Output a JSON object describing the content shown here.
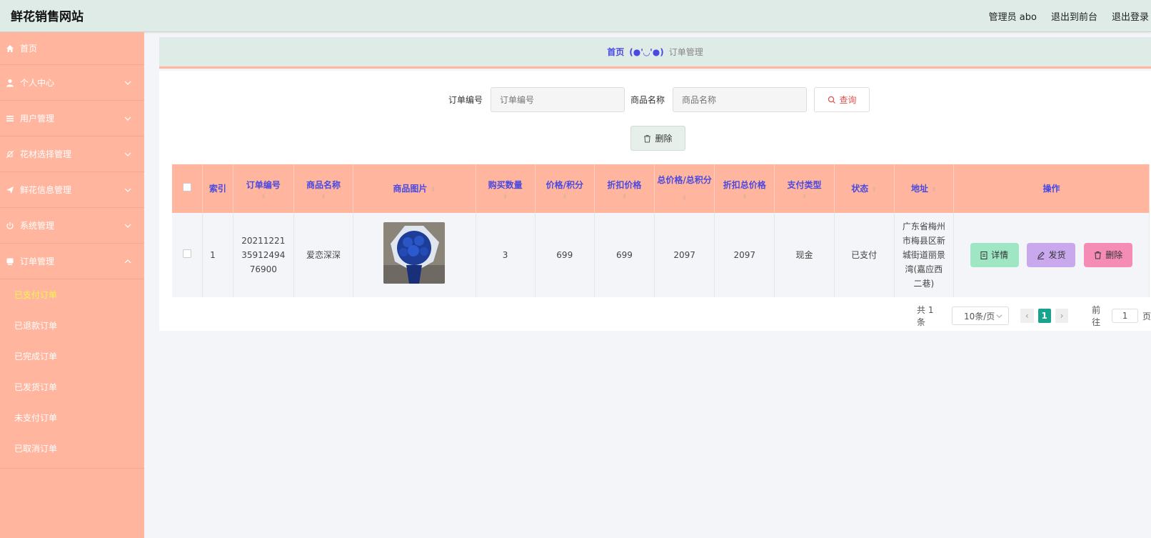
{
  "header": {
    "title": "鲜花销售网站",
    "admin": "管理员 abo",
    "back_front": "退出到前台",
    "logout": "退出登录"
  },
  "sidebar": {
    "items": [
      {
        "label": "首页",
        "icon": "home-icon"
      },
      {
        "label": "个人中心",
        "icon": "user-icon"
      },
      {
        "label": "用户管理",
        "icon": "list-icon"
      },
      {
        "label": "花材选择管理",
        "icon": "bell-off-icon"
      },
      {
        "label": "鲜花信息管理",
        "icon": "send-icon"
      },
      {
        "label": "系统管理",
        "icon": "power-icon"
      },
      {
        "label": "订单管理",
        "icon": "order-icon"
      }
    ],
    "sub_items": [
      "已支付订单",
      "已退款订单",
      "已完成订单",
      "已发货订单",
      "未支付订单",
      "已取消订单"
    ]
  },
  "breadcrumb": {
    "home": "首页",
    "face": "(●'◡'●)",
    "current": "订单管理"
  },
  "search": {
    "order_no_label": "订单编号",
    "order_no_placeholder": "订单编号",
    "product_label": "商品名称",
    "product_placeholder": "商品名称",
    "query_button": "查询"
  },
  "delete_button": "删除",
  "table": {
    "headers": [
      "索引",
      "订单编号",
      "商品名称",
      "商品图片",
      "购买数量",
      "价格/积分",
      "折扣价格",
      "总价格/总积分",
      "折扣总价格",
      "支付类型",
      "状态",
      "地址",
      "操作"
    ],
    "rows": [
      {
        "index": "1",
        "order_no": "202112213591249476900",
        "product": "爱恋深深",
        "quantity": "3",
        "price": "699",
        "discount_price": "699",
        "total": "2097",
        "discount_total": "2097",
        "pay_type": "现金",
        "status": "已支付",
        "address": "广东省梅州市梅县区新城街道丽景湾(嘉应西二巷)"
      }
    ],
    "actions": {
      "detail": "详情",
      "ship": "发货",
      "delete": "删除"
    }
  },
  "pager": {
    "total": "共 1 条",
    "size": "10条/页",
    "page": "1",
    "goto": "前往",
    "goto_value": "1",
    "page_unit": "页"
  },
  "colors": {
    "sidebar": "#ffb59e",
    "header": "#dfebe6",
    "accent": "#4a4ae0",
    "active_sub": "#f5f54b"
  }
}
